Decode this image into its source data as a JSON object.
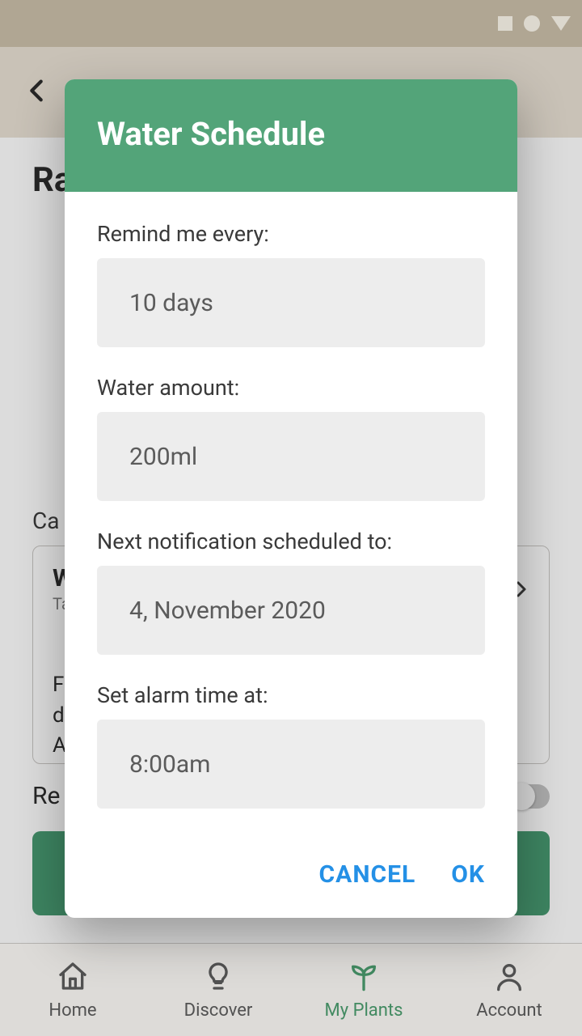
{
  "background": {
    "plant_title_partial": "Ra",
    "care_label_partial": "Ca",
    "card_title_partial": "W",
    "card_sub_partial": "Ta",
    "card_text_line1": "Fr",
    "card_text_line2": "da",
    "card_text_line3": "A",
    "reminder_label_partial": "Re"
  },
  "dialog": {
    "title": "Water Schedule",
    "fields": {
      "remind": {
        "label": "Remind me every:",
        "value": "10 days"
      },
      "amount": {
        "label": "Water amount:",
        "value": "200ml"
      },
      "next": {
        "label": "Next notification scheduled to:",
        "value": "4, November 2020"
      },
      "alarm": {
        "label": "Set alarm time at:",
        "value": "8:00am"
      }
    },
    "actions": {
      "cancel": "CANCEL",
      "ok": "OK"
    }
  },
  "nav": {
    "home": "Home",
    "discover": "Discover",
    "my_plants": "My Plants",
    "account": "Account"
  }
}
